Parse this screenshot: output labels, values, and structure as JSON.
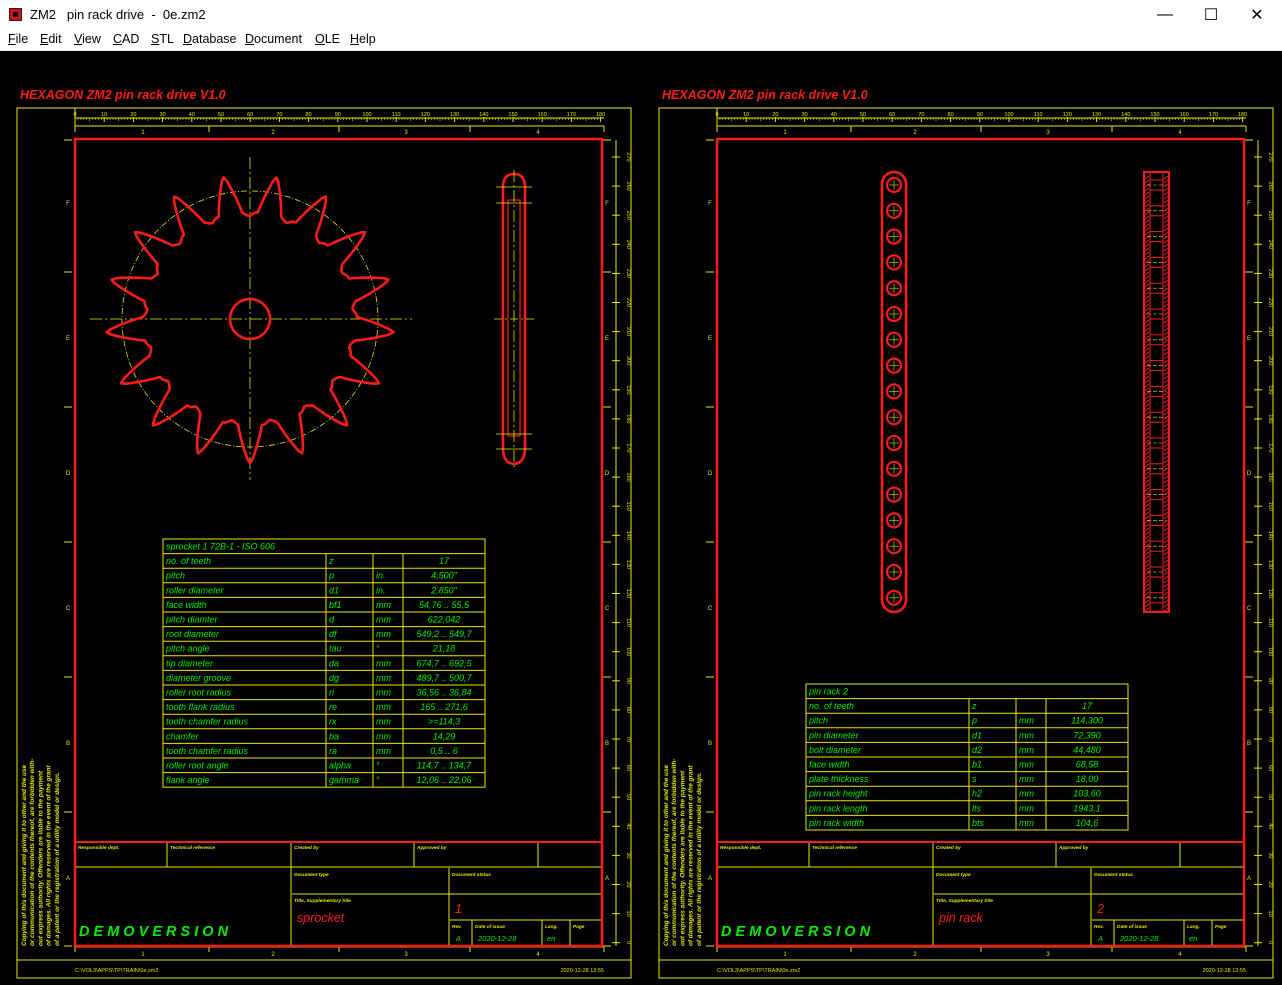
{
  "window": {
    "title": "ZM2   pin rack drive  -  0e.zm2",
    "minimize": "—",
    "maximize": "☐",
    "close": "✕"
  },
  "menu": [
    {
      "first": "F",
      "rest": "ile"
    },
    {
      "first": "E",
      "rest": "dit"
    },
    {
      "first": "V",
      "rest": "iew"
    },
    {
      "first": "C",
      "rest": "AD"
    },
    {
      "first": "S",
      "rest": "TL"
    },
    {
      "first": "D",
      "rest": "atabase"
    },
    {
      "first": "D",
      "rest": "ocument"
    },
    {
      "first": "O",
      "rest": "LE"
    },
    {
      "first": "H",
      "rest": "elp"
    }
  ],
  "colors": {
    "frame": "#e8e800",
    "red": "#ff1a1a",
    "green": "#00ee00",
    "bg": "#000000"
  },
  "icons": [
    "app-icon",
    "minimize-icon",
    "maximize-icon",
    "close-icon"
  ],
  "sheets": [
    {
      "header": "HEXAGON    ZM2    pin rack drive   V1.0",
      "ruler_numbers": [
        "0",
        "10",
        "20",
        "30",
        "40",
        "50",
        "60",
        "70",
        "80",
        "90",
        "100",
        "110",
        "120",
        "130",
        "140",
        "150",
        "160",
        "170",
        "180"
      ],
      "side_numbers": [
        "270",
        "260",
        "250",
        "240",
        "230",
        "220",
        "210",
        "200",
        "190",
        "180",
        "170",
        "160",
        "150",
        "140",
        "130",
        "120",
        "110",
        "100",
        "90",
        "80",
        "70",
        "60",
        "50",
        "40",
        "30",
        "20",
        "10",
        "0"
      ],
      "zone_numbers": [
        "1",
        "2",
        "3",
        "4"
      ],
      "zone_letters": [
        "F",
        "E",
        "D",
        "C",
        "B",
        "A"
      ],
      "copyright": [
        "Copying of this document and giving it to other and the use",
        "or communication of the contents thereof, are forbidden with-",
        "out express authority. Offenders are liable to the payment",
        "of damages. All rights are reserved in the event of the grant",
        "of a patent or the registration of a utility model or design."
      ],
      "table_title": "sprocket  1  72B-1 - ISO 606",
      "table_rows": [
        [
          "no. of teeth",
          "z",
          "",
          "17"
        ],
        [
          "pitch",
          "p",
          "in.",
          "4,500\""
        ],
        [
          "roller diameter",
          "d1",
          "in.",
          "2,850\""
        ],
        [
          "face width",
          "bf1",
          "mm",
          "54,76 .. 55,5"
        ],
        [
          "pitch diamter",
          "d",
          "mm",
          "622,042"
        ],
        [
          "root diameter",
          "df",
          "mm",
          "549,2 .. 549,7"
        ],
        [
          "pitch angle",
          "tau",
          "°",
          "21,18"
        ],
        [
          "tip diameter",
          "da",
          "mm",
          "674,7 .. 692,5"
        ],
        [
          "diameter groove",
          "dg",
          "mm",
          "489,7 .. 500,7"
        ],
        [
          "roller root radius",
          "ri",
          "mm",
          "36,56 .. 36,84"
        ],
        [
          "tooth flank radius",
          "re",
          "mm",
          "165 .. 271,6"
        ],
        [
          "tooth chamfer radius",
          "rx",
          "mm",
          ">=114,3"
        ],
        [
          "chamfer",
          "ba",
          "mm",
          "14,29"
        ],
        [
          "tooth chamfer radius",
          "ra",
          "mm",
          "0,5 .. 6"
        ],
        [
          "roller root angle",
          "alpha",
          "°",
          "114,7 .. 134,7"
        ],
        [
          "flank angle",
          "gamma",
          "°",
          "12,06 .. 22,06"
        ]
      ],
      "tb_labels": {
        "dept": "Responsible dept.",
        "tech": "Technical reference",
        "created": "Created by",
        "approved": "Approved by",
        "doctype": "Document type",
        "docstatus": "Document status",
        "title": "Title, Supplementary title",
        "rev": "Rev.",
        "date": "Date of issue",
        "lang": "Lang.",
        "page": "Page"
      },
      "demo": "D E M O V E R S I O N",
      "doc_title": "sprocket",
      "doc_no": "1",
      "rev": "A",
      "date": "2020-12-28",
      "lang": "en",
      "path": "C:\\VOL3\\APPS\\TP\\TRAIN\\0e.zm2",
      "stamp": "2020-12-28 13:55"
    },
    {
      "header": "HEXAGON    ZM2    pin rack drive   V1.0",
      "ruler_numbers": [
        "0",
        "10",
        "20",
        "30",
        "40",
        "50",
        "60",
        "70",
        "80",
        "90",
        "100",
        "110",
        "120",
        "130",
        "140",
        "150",
        "160",
        "170",
        "180"
      ],
      "side_numbers": [
        "270",
        "260",
        "250",
        "240",
        "230",
        "220",
        "210",
        "200",
        "190",
        "180",
        "170",
        "160",
        "150",
        "140",
        "130",
        "120",
        "110",
        "100",
        "90",
        "80",
        "70",
        "60",
        "50",
        "40",
        "30",
        "20",
        "10",
        "0"
      ],
      "zone_numbers": [
        "1",
        "2",
        "3",
        "4"
      ],
      "zone_letters": [
        "F",
        "E",
        "D",
        "C",
        "B",
        "A"
      ],
      "copyright": [
        "Copying of this document and giving it to other and the use",
        "or communication of the contents thereof, are forbidden with-",
        "out express authority. Offenders are liable to the payment",
        "of damages. All rights are reserved in the event of the grant",
        "of a patent or the registration of a utility model or design."
      ],
      "table_title": "pin rack  2",
      "table_rows": [
        [
          "no. of teeth",
          "z",
          "",
          "17"
        ],
        [
          "pitch",
          "p",
          "mm",
          "114,300"
        ],
        [
          "pin diameter",
          "d1",
          "mm",
          "72,390"
        ],
        [
          "bolt diameter",
          "d2",
          "mm",
          "44,480"
        ],
        [
          "face width",
          "b1",
          "mm",
          "68,58"
        ],
        [
          "plate thickness",
          "s",
          "mm",
          "18,00"
        ],
        [
          "pin rack height",
          "h2",
          "mm",
          "103,60"
        ],
        [
          "pin rack length",
          "lts",
          "mm",
          "1943,1"
        ],
        [
          "pin rack width",
          "bts",
          "mm",
          "104,6"
        ]
      ],
      "tb_labels": {
        "dept": "Responsible dept.",
        "tech": "Technical reference",
        "created": "Created by",
        "approved": "Approved by",
        "doctype": "Document type",
        "docstatus": "Document status",
        "title": "Title, Supplementary title",
        "rev": "Rev.",
        "date": "Date of issue",
        "lang": "Lang.",
        "page": "Page"
      },
      "demo": "D E M O V E R S I O N",
      "doc_title": "pin rack",
      "doc_no": "2",
      "rev": "A",
      "date": "2020-12-28",
      "lang": "en",
      "path": "C:\\VOL3\\APPS\\TP\\TRAIN\\0e.zm2",
      "stamp": "2020-12-28 13:55"
    }
  ]
}
